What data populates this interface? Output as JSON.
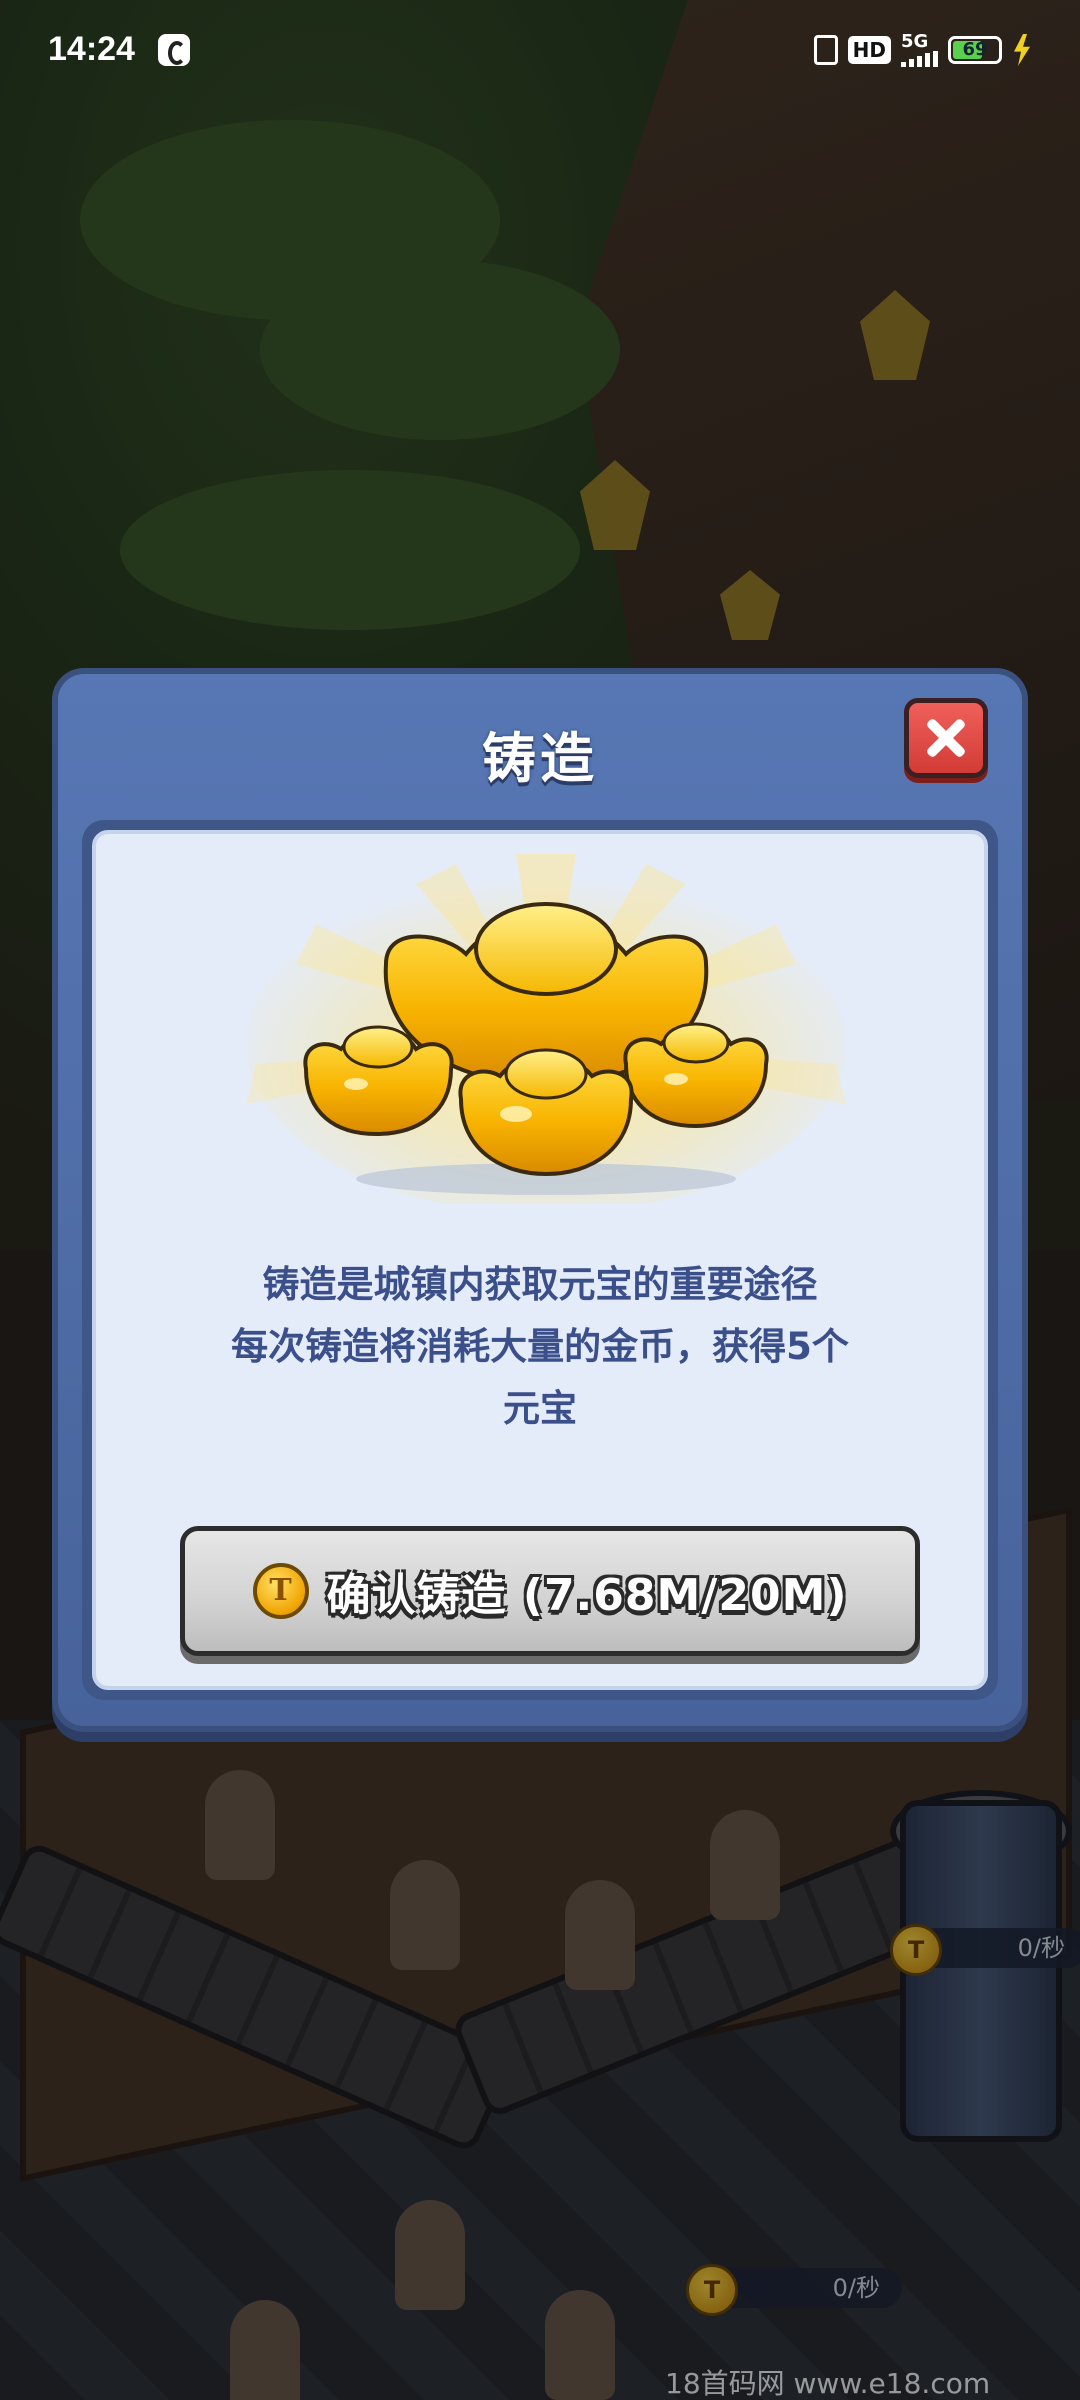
{
  "status_bar": {
    "time": "14:24",
    "hd": "HD",
    "network": "5G",
    "battery": "69",
    "battery_level": 0.69
  },
  "modal": {
    "title": "铸造",
    "description_lines": [
      "铸造是城镇内获取元宝的重要途径",
      "每次铸造将消耗大量的金币，获得5个",
      "元宝"
    ],
    "confirm_label": "确认铸造 (7.68M/20M)"
  },
  "background": {
    "rate_1": "0/秒",
    "rate_2": "0/秒",
    "coin_letter": "T",
    "watermark": "18首码网   www.e18.com"
  },
  "colors": {
    "modal_frame": "#5777b4",
    "panel": "#e4ecfa",
    "text": "#3b4f8a",
    "close_red": "#e04a44",
    "gold": "#f5b800"
  }
}
